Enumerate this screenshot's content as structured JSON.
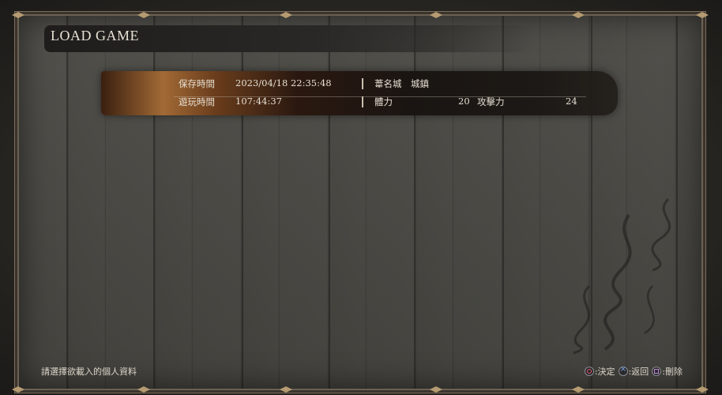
{
  "screen": {
    "title": "LOAD GAME"
  },
  "save_slot": {
    "save_time_label": "保存時間",
    "save_time_value": "2023/04/18 22:35:48",
    "location": "葦名城　城鎮",
    "play_time_label": "遊玩時間",
    "play_time_value": "107:44:37",
    "vitality_label": "體力",
    "vitality_value": "20",
    "attack_label": "攻擊力",
    "attack_value": "24"
  },
  "footer": {
    "hint": "請選擇欲載入的個人資料",
    "confirm_label": ":決定",
    "back_label": ":返回",
    "delete_label": ":刪除"
  },
  "colors": {
    "accent_brush": "#a26a35",
    "frame_trim": "#b59b72",
    "text": "#e6dfd3"
  },
  "icons": {
    "confirm": "circle-button-icon",
    "back": "cross-button-icon",
    "delete": "square-button-icon"
  }
}
